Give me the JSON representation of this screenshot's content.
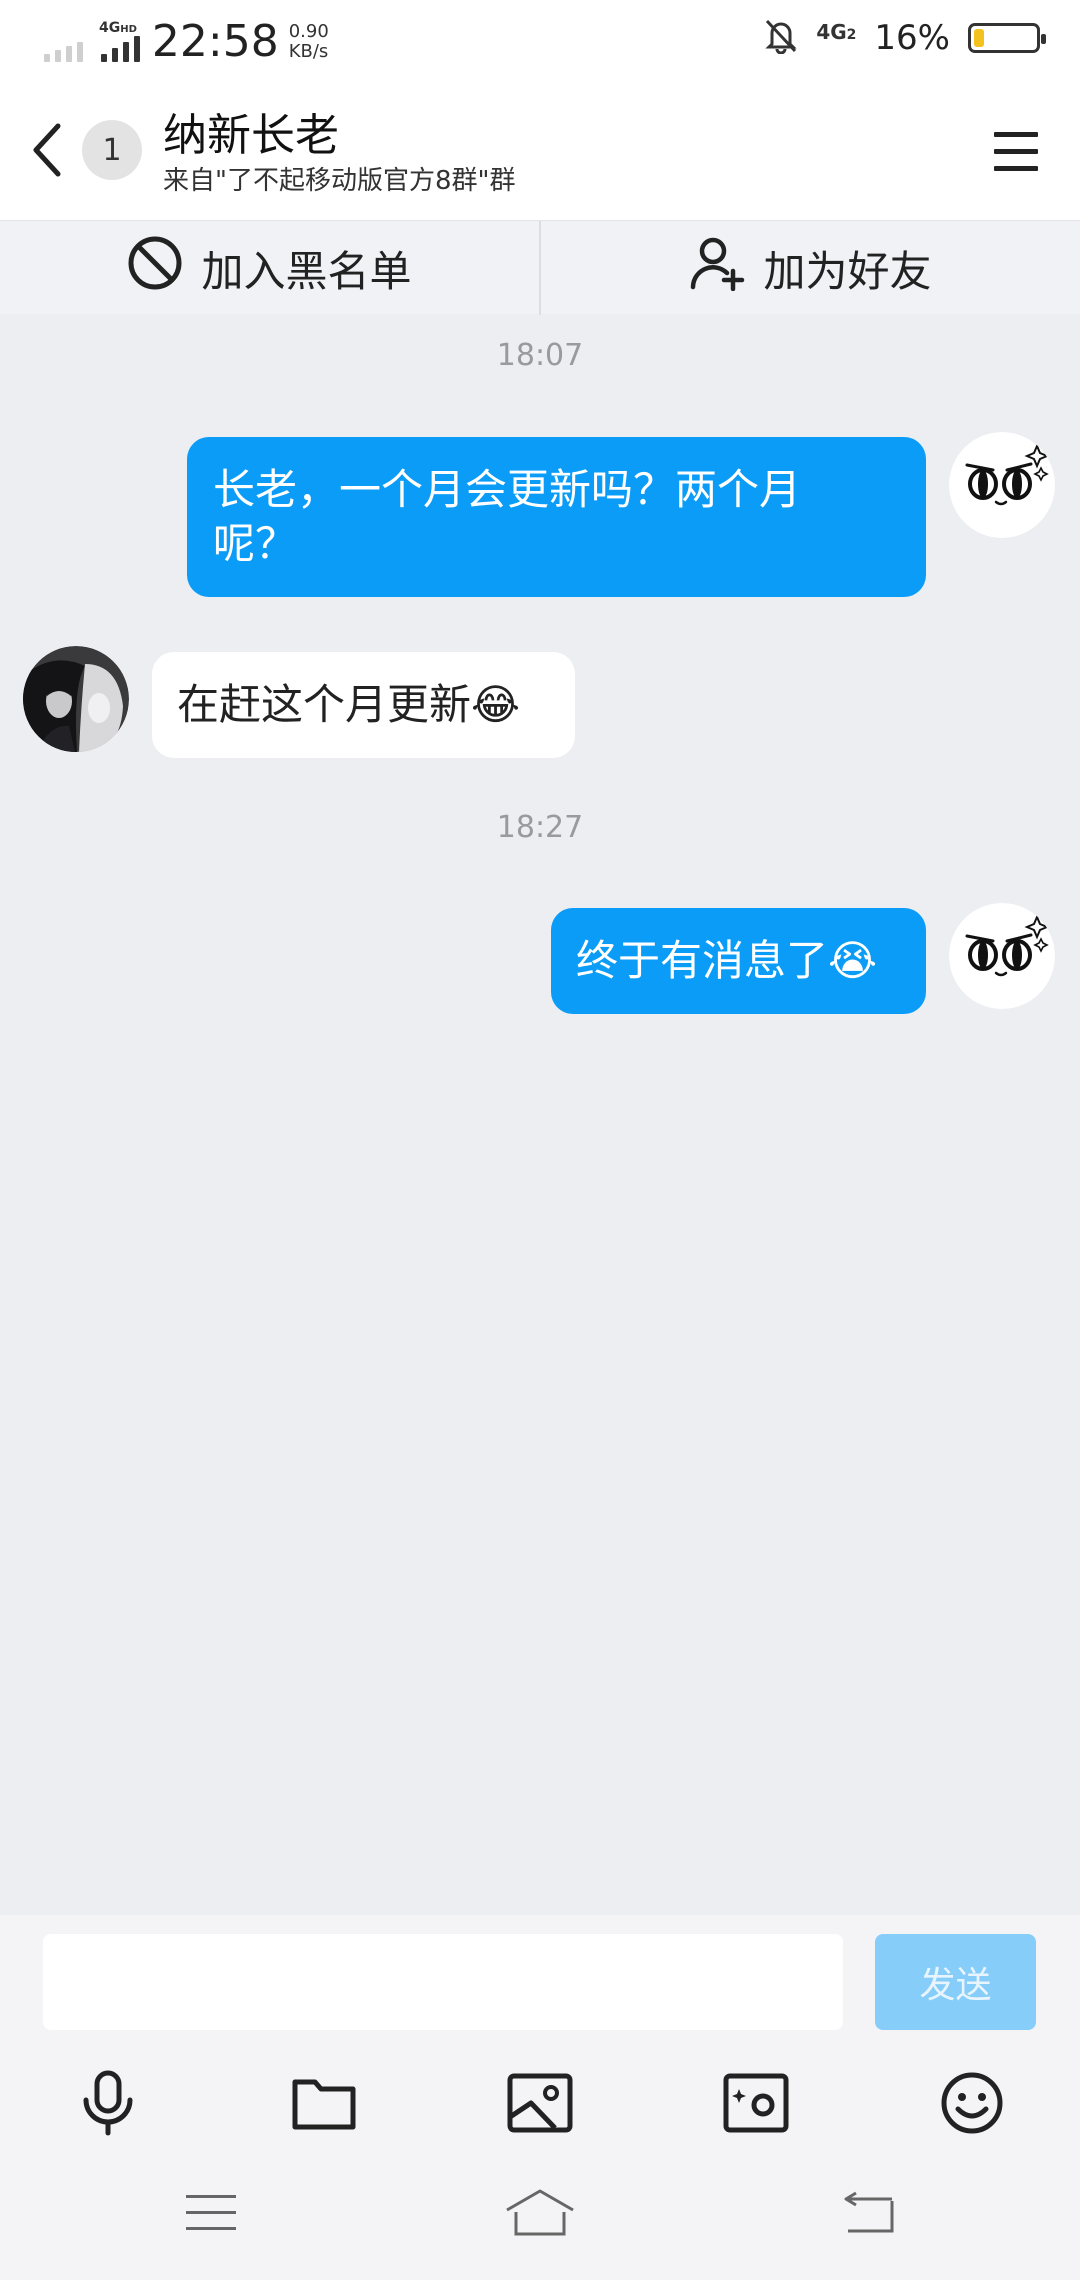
{
  "status_bar": {
    "network_type": "4G",
    "network_hd": "HD",
    "time": "22:58",
    "speed_value": "0.90",
    "speed_unit": "KB/s",
    "network_type_2": "4G",
    "sim_index": "2",
    "battery_percent_text": "16%",
    "battery_level": 0.16
  },
  "header": {
    "unread_count": "1",
    "title": "纳新长老",
    "subtitle": "来自\"了不起移动版官方8群\"群"
  },
  "action_bar": {
    "blacklist_label": "加入黑名单",
    "add_friend_label": "加为好友"
  },
  "messages": [
    {
      "kind": "timestamp",
      "text": "18:07"
    },
    {
      "kind": "bubble",
      "direction": "out",
      "line1": "长老，一个月会更新吗？两个月",
      "line2": "呢？"
    },
    {
      "kind": "bubble",
      "direction": "in",
      "text": "在赶这个月更新",
      "emoji": "😂"
    },
    {
      "kind": "timestamp",
      "text": "18:27"
    },
    {
      "kind": "bubble",
      "direction": "out",
      "text": "终于有消息了",
      "emoji": "😭"
    }
  ],
  "input_bar": {
    "send_label": "发送"
  },
  "toolbar": {
    "icons": [
      "microphone-icon",
      "folder-icon",
      "image-icon",
      "camera-icon",
      "emoji-icon"
    ]
  },
  "nav_bar": {
    "icons": [
      "menu-icon",
      "home-icon",
      "back-icon"
    ]
  },
  "colors": {
    "outgoing_bubble": "#0a9cf7",
    "incoming_bubble": "#ffffff",
    "chat_background": "#edeef2",
    "send_button": "#87cdf9",
    "battery_fill": "#f4c21e"
  }
}
